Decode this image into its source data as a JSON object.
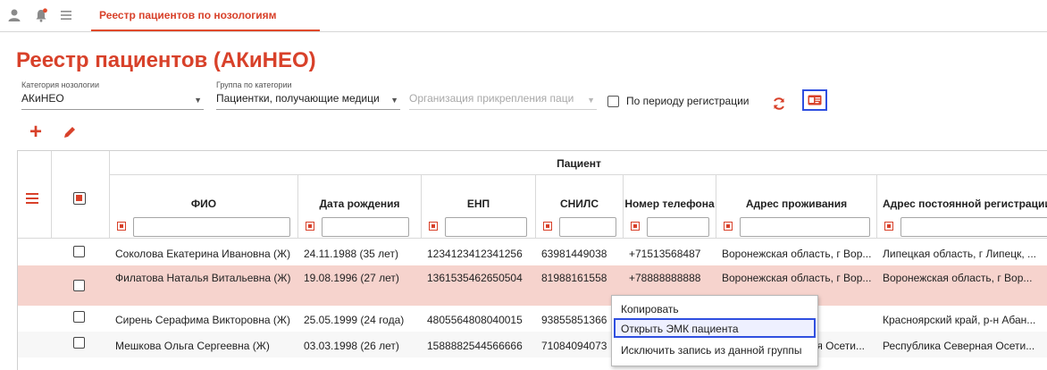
{
  "topbar": {
    "icons": [
      "user-icon",
      "notification-bell-icon",
      "menu-icon"
    ],
    "tab_label": "Реестр пациентов по нозологиям"
  },
  "page": {
    "title": "Реестр пациентов (АКиНЕО)"
  },
  "filters": {
    "category": {
      "label": "Категория нозологии",
      "value": "АКиНЕО"
    },
    "group": {
      "label": "Группа по категории",
      "value": "Пациентки, получающие медици"
    },
    "organization": {
      "placeholder": "Организация прикрепления паци"
    },
    "period_label": "По периоду регистрации"
  },
  "toolbar": {
    "add_icon": "plus-icon",
    "edit_icon": "pencil-icon",
    "refresh_icon": "refresh-icon",
    "card_icon": "id-card-icon"
  },
  "table": {
    "group_header": "Пациент",
    "columns": [
      "ФИО",
      "Дата рождения",
      "ЕНП",
      "СНИЛС",
      "Номер телефона",
      "Адрес проживания",
      "Адрес постоянной регистрации"
    ],
    "rows": [
      {
        "fio": "Соколова Екатерина Ивановна (Ж)",
        "dob": "24.11.1988 (35 лет)",
        "enp": "1234123412341256",
        "snils": "63981449038",
        "phone": "+71513568487",
        "addr": "Воронежская область, г Вор...",
        "reg": "Липецкая область, г Липецк, ..."
      },
      {
        "fio": "Филатова Наталья Витальевна (Ж)",
        "dob": "19.08.1996 (27 лет)",
        "enp": "1361535462650504",
        "snils": "81988161558",
        "phone": "+78888888888",
        "addr": "Воронежская область, г Вор...",
        "reg": "Воронежская область, г Вор..."
      },
      {
        "fio": "Сирень Серафима Викторовна (Ж)",
        "dob": "25.05.1999 (24 года)",
        "enp": "4805564808040015",
        "snils": "93855851366",
        "phone": "",
        "addr": "",
        "reg": "Красноярский край, р-н Абан..."
      },
      {
        "fio": "Мешкова Ольга Сергеевна (Ж)",
        "dob": "03.03.1998 (26 лет)",
        "enp": "1588882544566666",
        "snils": "71084094073",
        "phone": "",
        "addr": "ая Осети...",
        "reg": "Республика Северная Осети..."
      }
    ]
  },
  "context_menu": {
    "items": [
      "Копировать",
      "Открыть ЭМК пациента",
      "Исключить запись из данной группы"
    ],
    "highlighted": "Открыть ЭМК пациента"
  }
}
